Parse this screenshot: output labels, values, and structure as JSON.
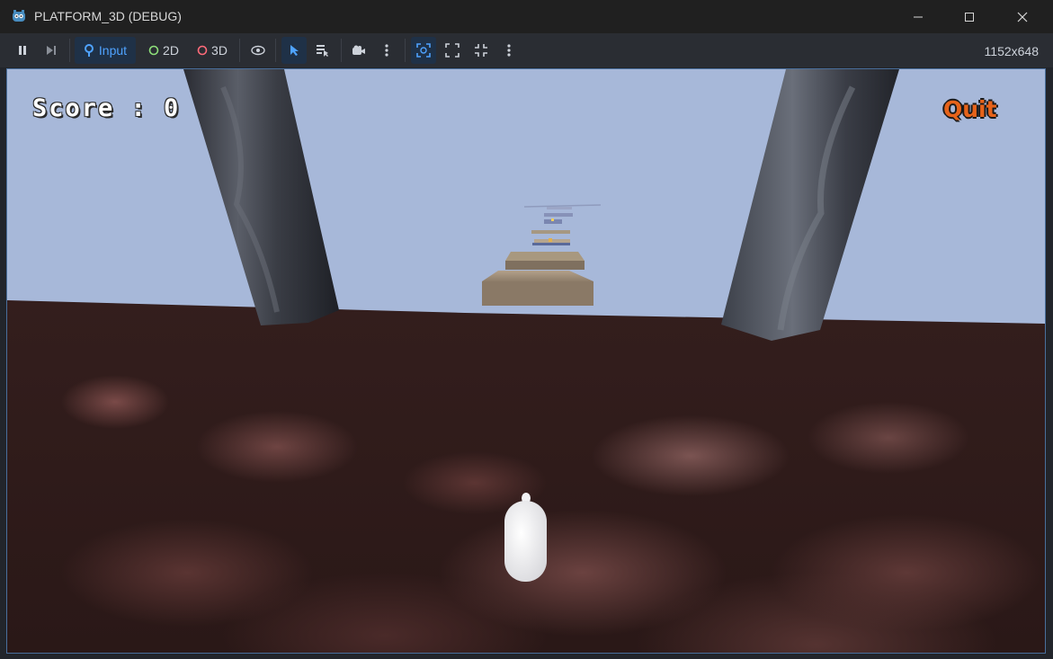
{
  "window": {
    "title": "PLATFORM_3D (DEBUG)"
  },
  "toolbar": {
    "input_label": "Input",
    "mode_2d_label": "2D",
    "mode_3d_label": "3D",
    "resolution": "1152x648",
    "colors": {
      "accent": "#4fa3ff",
      "mode_2d": "#8ee07a",
      "mode_3d": "#ff6b7a"
    }
  },
  "game": {
    "score_text": "Score : 0",
    "quit_label": "Quit"
  },
  "icons": [
    "godot-icon",
    "minimize-icon",
    "maximize-icon",
    "close-icon",
    "pause-icon",
    "step-icon",
    "input-icon",
    "eye-icon",
    "pointer-icon",
    "list-select-icon",
    "camera-icon",
    "more-icon",
    "focus-icon",
    "fullscreen-icon",
    "expand-icon"
  ]
}
